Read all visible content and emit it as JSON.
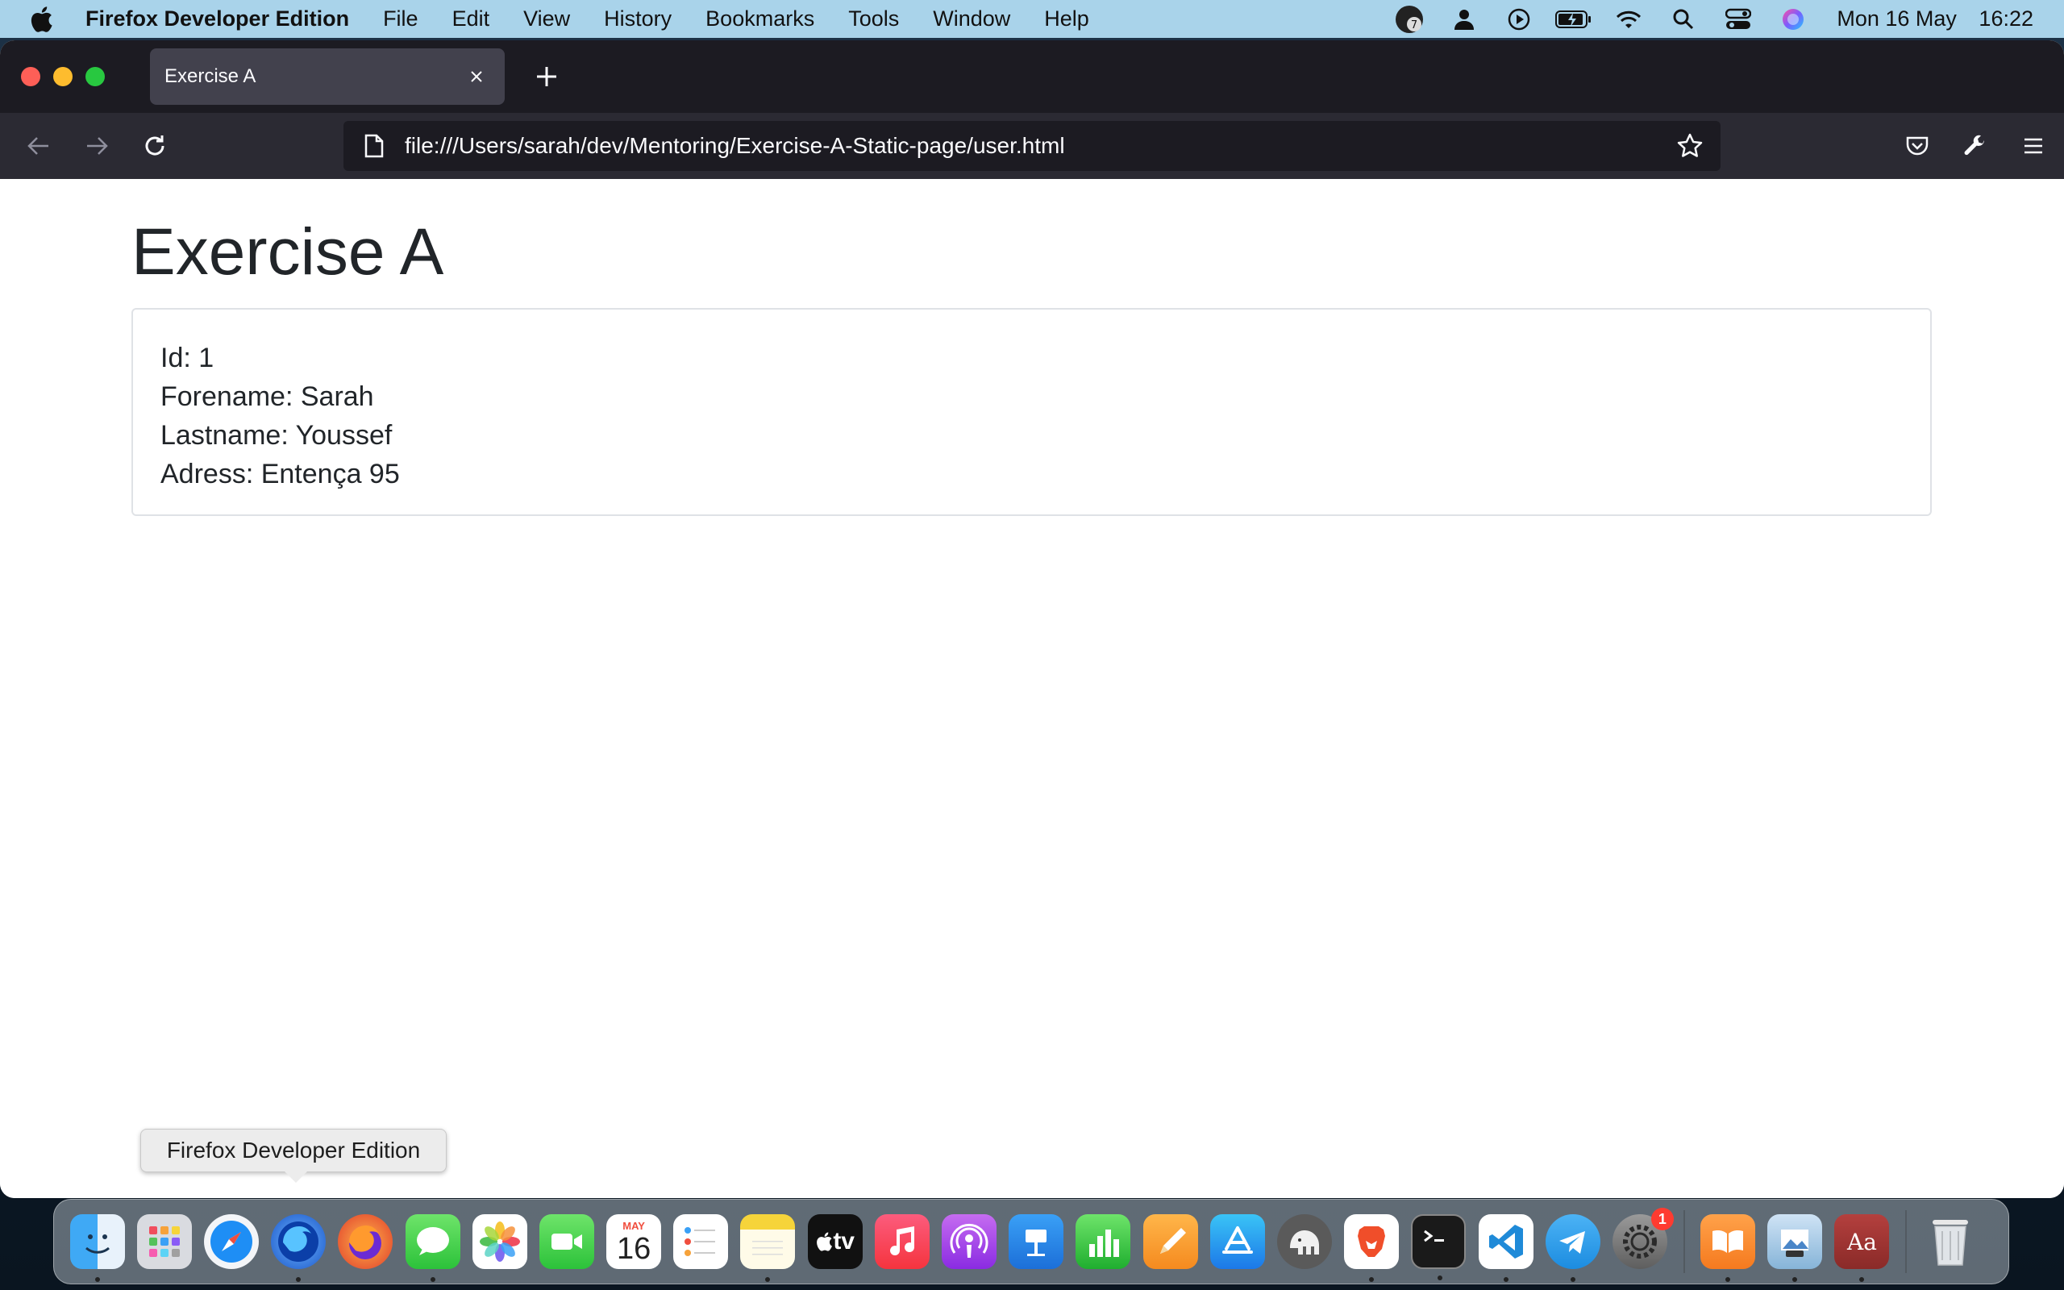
{
  "menubar": {
    "app_name": "Firefox Developer Edition",
    "menus": [
      "File",
      "Edit",
      "View",
      "History",
      "Bookmarks",
      "Tools",
      "Window",
      "Help"
    ],
    "status_icons": [
      "notification-7-icon",
      "user-icon",
      "play-icon",
      "battery-icon",
      "wifi-icon",
      "search-icon",
      "control-center-icon",
      "siri-icon"
    ],
    "notification_count": "7",
    "date": "Mon 16 May",
    "time": "16:22"
  },
  "browser": {
    "tab_title": "Exercise A",
    "url": "file:///Users/sarah/dev/Mentoring/Exercise-A-Static-page/user.html"
  },
  "page": {
    "title": "Exercise A",
    "fields": [
      "Id: 1",
      "Forename: Sarah",
      "Lastname: Youssef",
      "Adress: Entença 95"
    ]
  },
  "tooltip": {
    "text": "Firefox Developer Edition"
  },
  "dock": {
    "calendar_month": "MAY",
    "calendar_day": "16",
    "tv_label": "tv",
    "dictionary_label": "Aa",
    "settings_badge": "1",
    "apps": [
      "finder",
      "launchpad",
      "safari",
      "firefox-developer-edition",
      "firefox",
      "messages",
      "photos",
      "facetime",
      "calendar",
      "reminders",
      "notes",
      "apple-tv",
      "music",
      "podcasts",
      "keynote",
      "numbers",
      "pages",
      "app-store",
      "tableplus",
      "brave",
      "terminal",
      "vscode",
      "telegram",
      "system-preferences",
      "books",
      "preview",
      "dictionary",
      "trash"
    ]
  }
}
